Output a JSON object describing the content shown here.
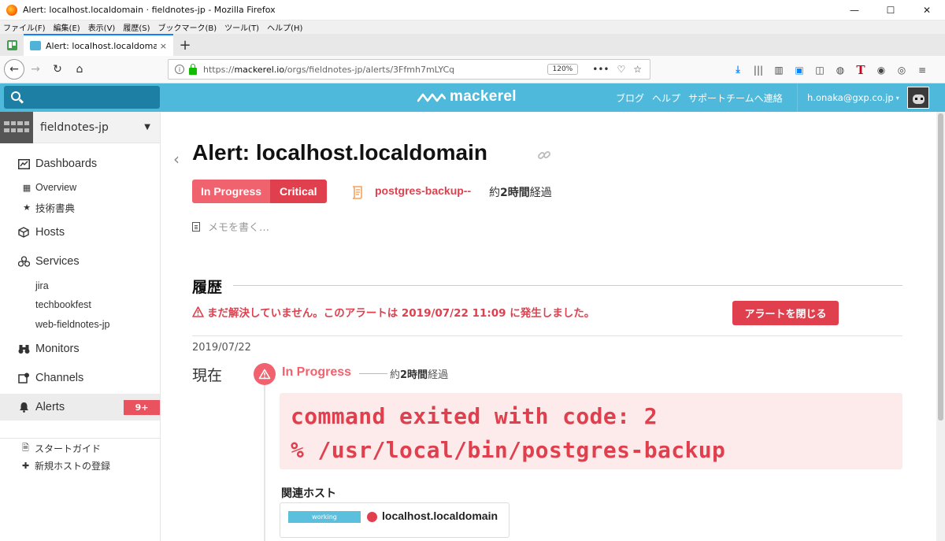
{
  "window": {
    "title": "Alert: localhost.localdomain · fieldnotes-jp - Mozilla Firefox",
    "minimize": "—",
    "maximize": "☐",
    "close": "✕"
  },
  "menubar": [
    "ファイル(F)",
    "編集(E)",
    "表示(V)",
    "履歴(S)",
    "ブックマーク(B)",
    "ツール(T)",
    "ヘルプ(H)"
  ],
  "tabs": {
    "active_label": "Alert: localhost.localdomain · fi",
    "close": "×",
    "new_tab": "+"
  },
  "navbar": {
    "url_prefix": "https://",
    "url_host": "mackerel.io",
    "url_path": "/orgs/fieldnotes-jp/alerts/3Ffmh7mLYCq",
    "zoom": "120%",
    "more": "•••"
  },
  "header": {
    "brand": "mackerel",
    "links": [
      "ブログ",
      "ヘルプ",
      "サポートチームへ連絡"
    ],
    "user_email": "h.onaka@gxp.co.jp",
    "user_caret": "▾"
  },
  "sidebar": {
    "org_name": "fieldnotes-jp",
    "org_caret": "▼",
    "items": [
      {
        "label": "Dashboards",
        "icon": "dashboard-icon"
      },
      {
        "label": "Overview",
        "icon": "grid-icon"
      },
      {
        "label": "技術書典",
        "icon": "star-icon"
      },
      {
        "label": "Hosts",
        "icon": "cube-icon"
      },
      {
        "label": "Services",
        "icon": "services-icon"
      },
      {
        "label": "jira"
      },
      {
        "label": "techbookfest"
      },
      {
        "label": "web-fieldnotes-jp"
      },
      {
        "label": "Monitors",
        "icon": "binoculars-icon"
      },
      {
        "label": "Channels",
        "icon": "channels-icon"
      },
      {
        "label": "Alerts",
        "icon": "bell-icon",
        "badge": "9+"
      }
    ],
    "footer": [
      {
        "label": "スタートガイド",
        "icon": "document-icon"
      },
      {
        "label": "新規ホストの登録",
        "icon": "plus-icon"
      }
    ]
  },
  "main": {
    "title": "Alert: localhost.localdomain",
    "status": "In Progress",
    "severity": "Critical",
    "monitor_name": "postgres-backup--",
    "elapsed_prefix": "約",
    "elapsed_value": "2時間",
    "elapsed_suffix": "経過",
    "memo_placeholder": "メモを書く…",
    "history_title": "履歴",
    "unresolved_message": "まだ解決していません。このアラートは 2019/07/22 11:09 に発生しました。",
    "close_button": "アラートを閉じる",
    "date": "2019/07/22",
    "now_label": "現在",
    "timeline_status": "In Progress",
    "timeline_elapsed_prefix": "約",
    "timeline_elapsed_value": "2時間",
    "timeline_elapsed_suffix": "経過",
    "output_lines": [
      "command exited with code: 2",
      "% /usr/local/bin/postgres-backup"
    ],
    "related_hosts_title": "関連ホスト",
    "host_status": "working",
    "host_name": "localhost.localdomain"
  },
  "colors": {
    "header_bg": "#4fb9db",
    "critical": "#e0404e",
    "in_progress": "#f0626d",
    "output_bg": "#fdebeb"
  }
}
